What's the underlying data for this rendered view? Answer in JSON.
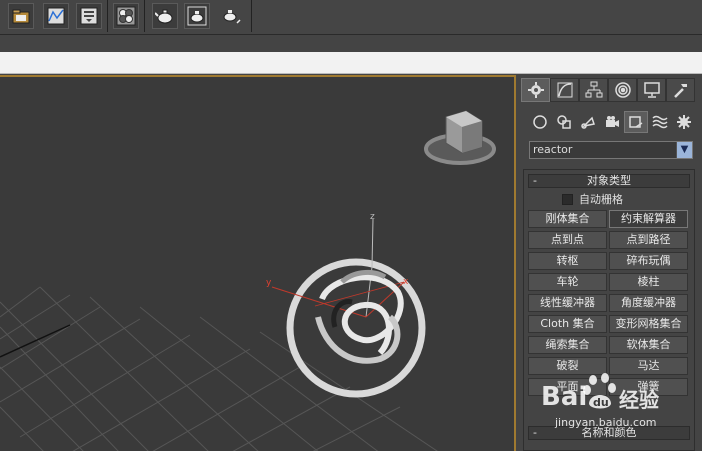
{
  "toolbar": {
    "buttons": [
      "open-icon",
      "curve-editor-icon",
      "render-setup-icon",
      "material-editor-icon",
      "teapot-render-icon",
      "teapot-frame-icon",
      "teapot-quick-icon"
    ]
  },
  "command_panel": {
    "tabs": [
      "create-tab",
      "modify-tab",
      "hierarchy-tab",
      "motion-tab",
      "display-tab",
      "utilities-tab"
    ],
    "subtabs": [
      "geometry",
      "shapes",
      "lights",
      "cameras",
      "helpers",
      "space-warps",
      "systems"
    ],
    "category": "reactor",
    "object_type_header": "对象类型",
    "auto_grid_label": "自动栅格",
    "buttons": [
      [
        "刚体集合",
        "约束解算器"
      ],
      [
        "点到点",
        "点到路径"
      ],
      [
        "转枢",
        "碎布玩偶"
      ],
      [
        "车轮",
        "棱柱"
      ],
      [
        "线性缓冲器",
        "角度缓冲器"
      ],
      [
        "Cloth 集合",
        "变形网格集合"
      ],
      [
        "绳索集合",
        "软体集合"
      ],
      [
        "破裂",
        "马达"
      ],
      [
        "平面",
        "弹簧"
      ]
    ],
    "active_button": "约束解算器",
    "name_color_header": "名称和颜色",
    "minus": "-"
  },
  "viewport": {
    "axis_x": "x",
    "axis_y": "y",
    "axis_z": "z"
  },
  "watermark": {
    "brand_left": "Bai",
    "brand_right": "经验",
    "url": "jingyan.baidu.com"
  },
  "colors": {
    "viewport_bg": "#3a3a3a",
    "grid": "#555555",
    "active_border": "#a07a30",
    "panel_bg": "#444444"
  }
}
